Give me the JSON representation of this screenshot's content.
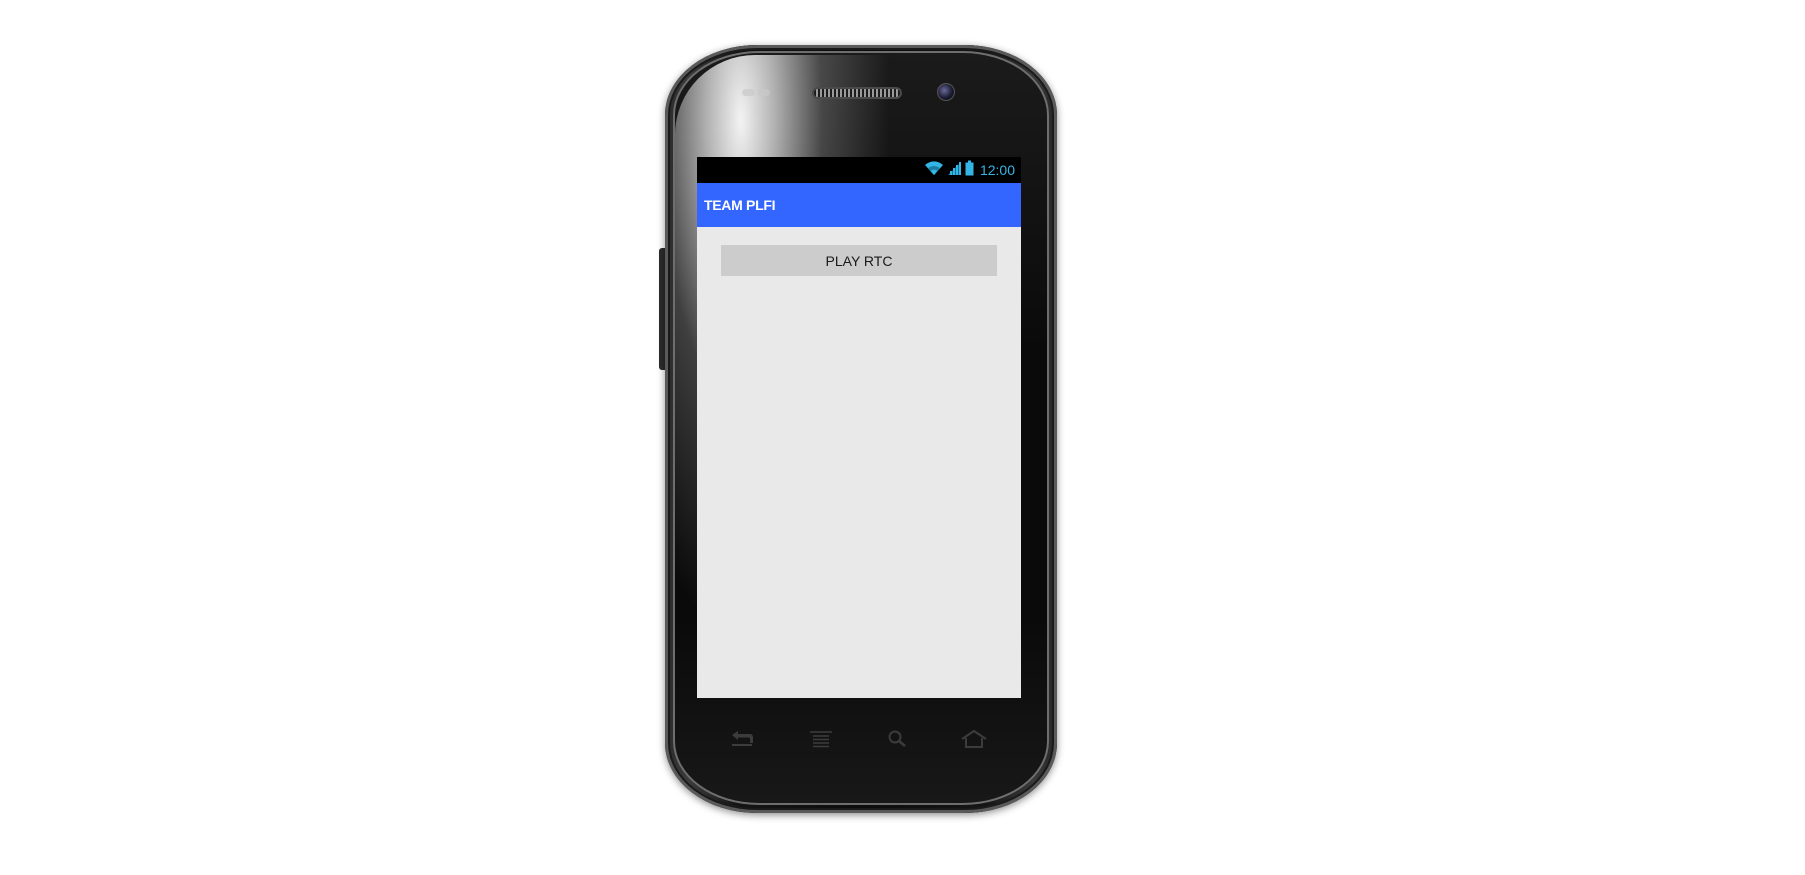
{
  "status_bar": {
    "time": "12:00",
    "icons": [
      "wifi-icon",
      "signal-icon",
      "battery-icon"
    ],
    "accent_color": "#33b5e5"
  },
  "app_bar": {
    "title": "TEAM PLFI",
    "color": "#3366ff"
  },
  "main": {
    "play_button_label": "PLAY RTC"
  },
  "device_nav": {
    "icons": [
      "back-icon",
      "menu-icon",
      "search-icon",
      "home-icon"
    ]
  }
}
